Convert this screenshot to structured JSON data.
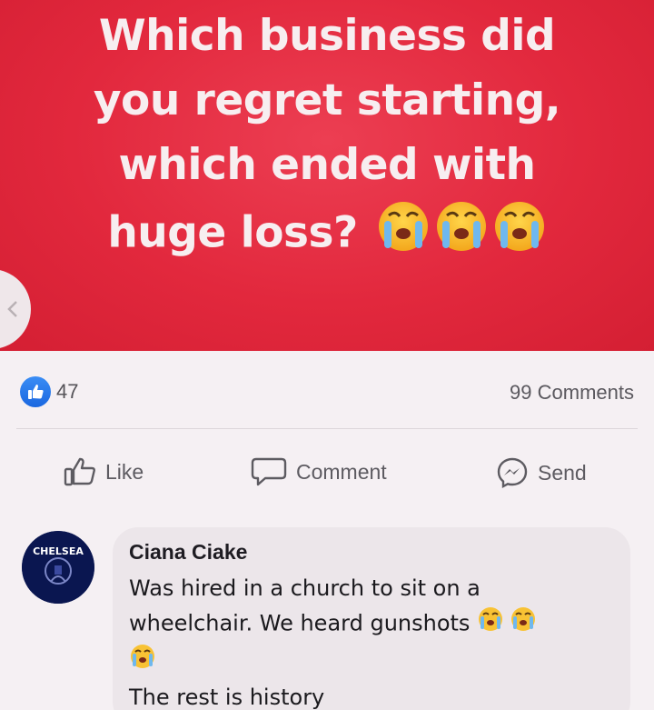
{
  "post": {
    "line1": "Which business did",
    "line2": "you regret starting,",
    "line3": "which ended with",
    "line4": "huge loss?",
    "line4_emoji": "😭😭😭",
    "background_color": "#e2283d"
  },
  "stats": {
    "reactions_count": "47",
    "comments_label": "99 Comments"
  },
  "actions": {
    "like_label": "Like",
    "comment_label": "Comment",
    "send_label": "Send"
  },
  "comment": {
    "avatar_text": "CHELSEA",
    "author": "Ciana Ciake",
    "text_part1": "Was hired in a church to sit on a",
    "text_part2": "wheelchair. We heard gunshots",
    "text_emoji": "😭😭😭",
    "text_part3": "The rest is history"
  },
  "colors": {
    "reaction_blue": "#1a67e0",
    "muted_text": "#5d5b61"
  },
  "icons": [
    "chevron-left-icon",
    "thumbs-up-icon",
    "speech-bubble-icon",
    "messenger-icon",
    "crying-face-icon"
  ]
}
